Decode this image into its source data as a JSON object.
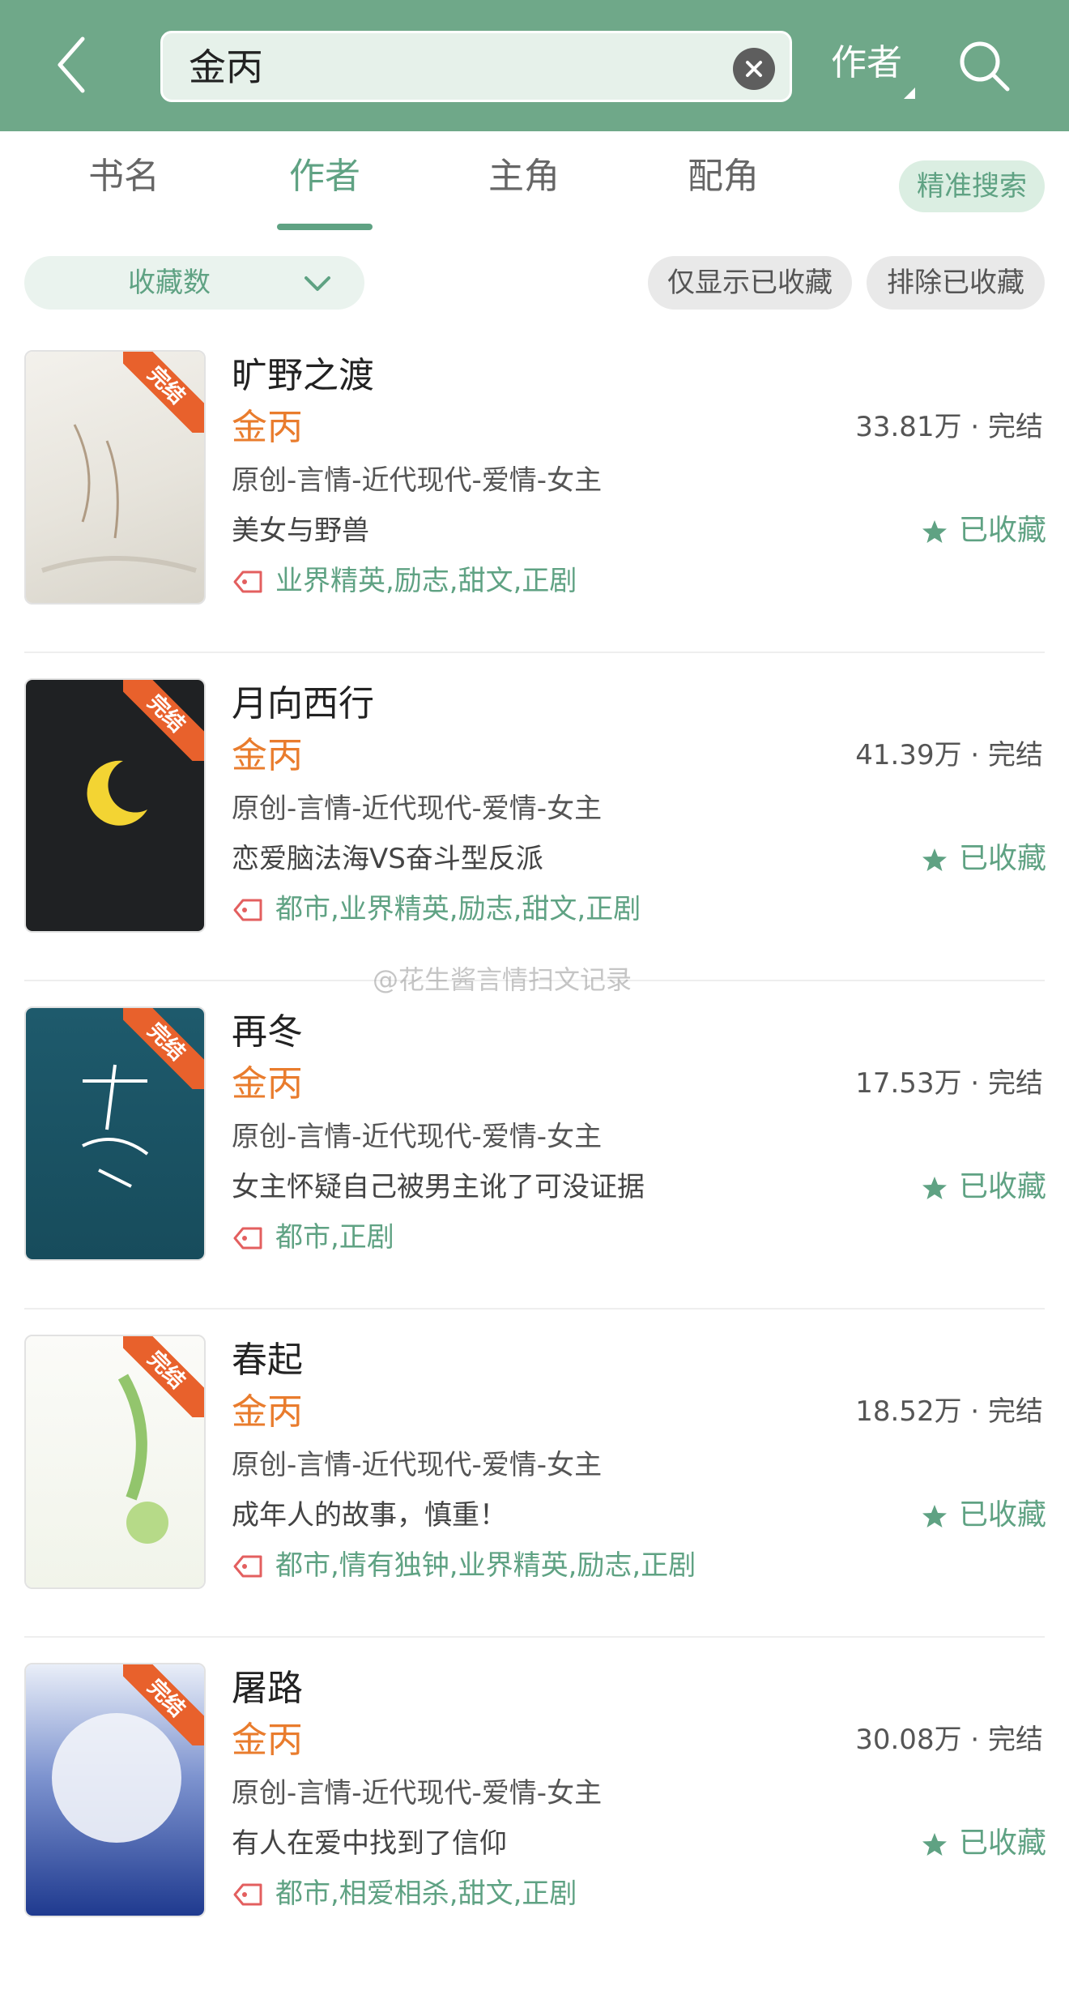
{
  "header": {
    "search_value": "金丙",
    "search_type": "作者"
  },
  "tabs": [
    {
      "label": "书名"
    },
    {
      "label": "作者"
    },
    {
      "label": "主角"
    },
    {
      "label": "配角"
    }
  ],
  "precise_search_label": "精准搜索",
  "filters": {
    "sort_label": "收藏数",
    "only_collected": "仅显示已收藏",
    "exclude_collected": "排除已收藏"
  },
  "books": [
    {
      "title": "旷野之渡",
      "author": "金丙",
      "stats": "33.81万 · 完结",
      "genre": "原创-言情-近代现代-爱情-女主",
      "intro": "美女与野兽",
      "fav": "已收藏",
      "tags": "业界精英,励志,甜文,正剧",
      "ribbon": "完结"
    },
    {
      "title": "月向西行",
      "author": "金丙",
      "stats": "41.39万 · 完结",
      "genre": "原创-言情-近代现代-爱情-女主",
      "intro": "恋爱脑法海VS奋斗型反派",
      "fav": "已收藏",
      "tags": "都市,业界精英,励志,甜文,正剧",
      "ribbon": "完结"
    },
    {
      "title": "再冬",
      "author": "金丙",
      "stats": "17.53万 · 完结",
      "genre": "原创-言情-近代现代-爱情-女主",
      "intro": "女主怀疑自己被男主讹了可没证据",
      "fav": "已收藏",
      "tags": "都市,正剧",
      "ribbon": "完结"
    },
    {
      "title": "春起",
      "author": "金丙",
      "stats": "18.52万 · 完结",
      "genre": "原创-言情-近代现代-爱情-女主",
      "intro": "成年人的故事，慎重！",
      "fav": "已收藏",
      "tags": "都市,情有独钟,业界精英,励志,正剧",
      "ribbon": "完结"
    },
    {
      "title": "屠路",
      "author": "金丙",
      "stats": "30.08万 · 完结",
      "genre": "原创-言情-近代现代-爱情-女主",
      "intro": "有人在爱中找到了信仰",
      "fav": "已收藏",
      "tags": "都市,相爱相杀,甜文,正剧",
      "ribbon": "完结"
    }
  ],
  "watermark": "@花生酱言情扫文记录",
  "colors": {
    "header_bg": "#6fa889",
    "accent_green": "#5fa283",
    "author_orange": "#e97c2d",
    "ribbon": "#e8612c"
  }
}
